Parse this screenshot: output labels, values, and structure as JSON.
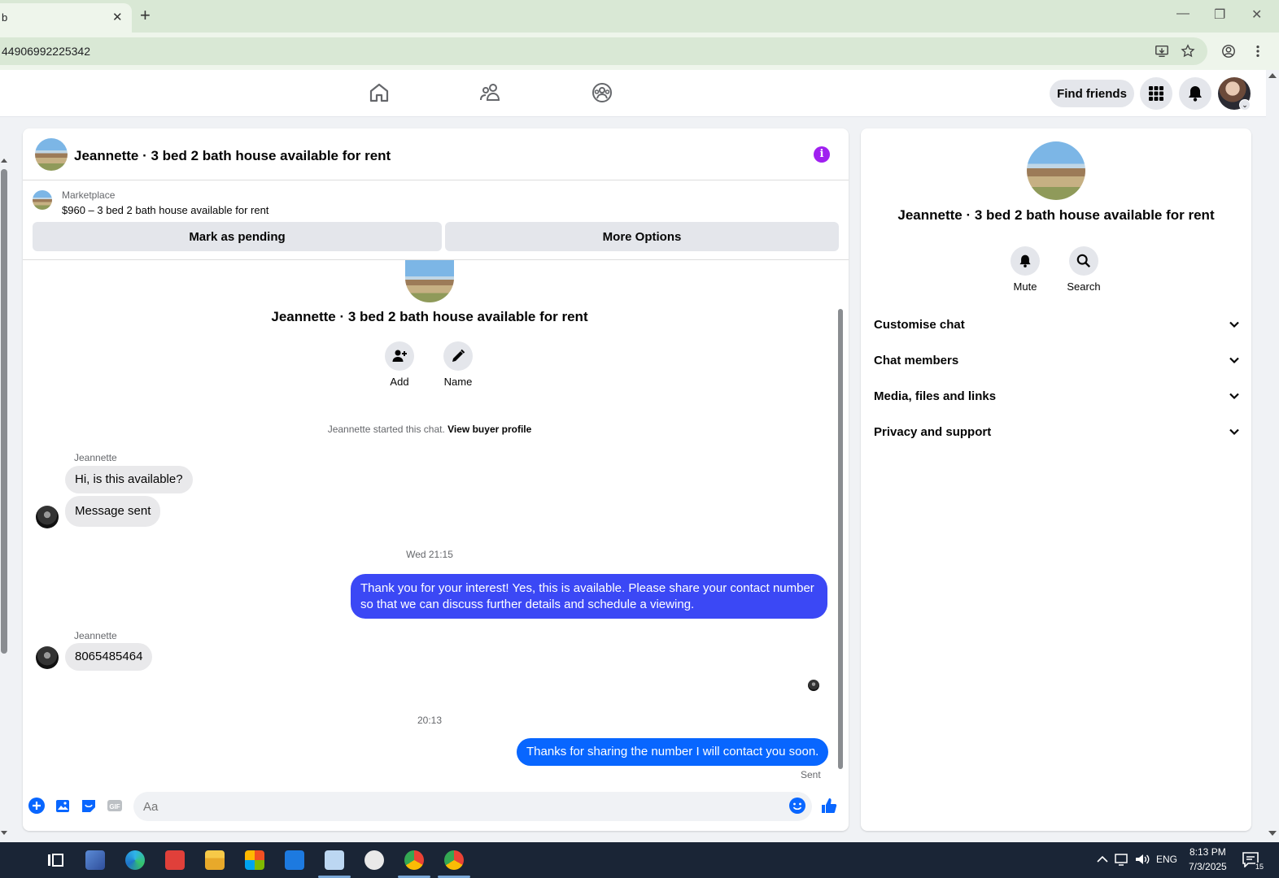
{
  "browser": {
    "tab_title": "b",
    "tab_close": "✕",
    "new_tab": "+",
    "url": "44906992225342",
    "minimize": "—",
    "restore": "❐",
    "close": "✕"
  },
  "fbnav": {
    "find_friends": "Find friends"
  },
  "chat": {
    "header_title": "Jeannette · 3 bed 2 bath house available for rent",
    "info_glyph": "i",
    "marketplace_label": "Marketplace",
    "listing": "$960 – 3 bed 2 bath house available for rent",
    "mark_pending": "Mark as pending",
    "more_options": "More Options",
    "intro_title": "Jeannette · 3 bed 2 bath house available for rent",
    "add_label": "Add",
    "name_label": "Name",
    "started_text": "Jeannette started this chat.",
    "view_profile": "View buyer profile",
    "messages": [
      {
        "sender": "Jeannette",
        "text": "Hi, is this available?"
      },
      {
        "text": "Message sent"
      },
      {
        "time": "Wed 21:15"
      },
      {
        "text": "Thank you for your interest! Yes, this is available. Please share your contact number so that we can discuss further details and schedule a viewing."
      },
      {
        "sender": "Jeannette",
        "text": "8065485464"
      },
      {
        "time": "20:13"
      },
      {
        "text": "Thanks for sharing the number I will contact you soon."
      }
    ],
    "sent_status": "Sent",
    "composer_placeholder": "Aa"
  },
  "info_panel": {
    "title": "Jeannette · 3 bed 2 bath house available for rent",
    "mute": "Mute",
    "search": "Search",
    "sections": [
      "Customise chat",
      "Chat members",
      "Media, files and links",
      "Privacy and support"
    ]
  },
  "taskbar": {
    "language": "ENG",
    "time": "8:13 PM",
    "date": "7/3/2025",
    "notification_count": "15"
  },
  "colors": {
    "accent_blue": "#0866ff",
    "outgoing_purple_blue": "#3b48f5",
    "info_purple": "#a020f0"
  }
}
